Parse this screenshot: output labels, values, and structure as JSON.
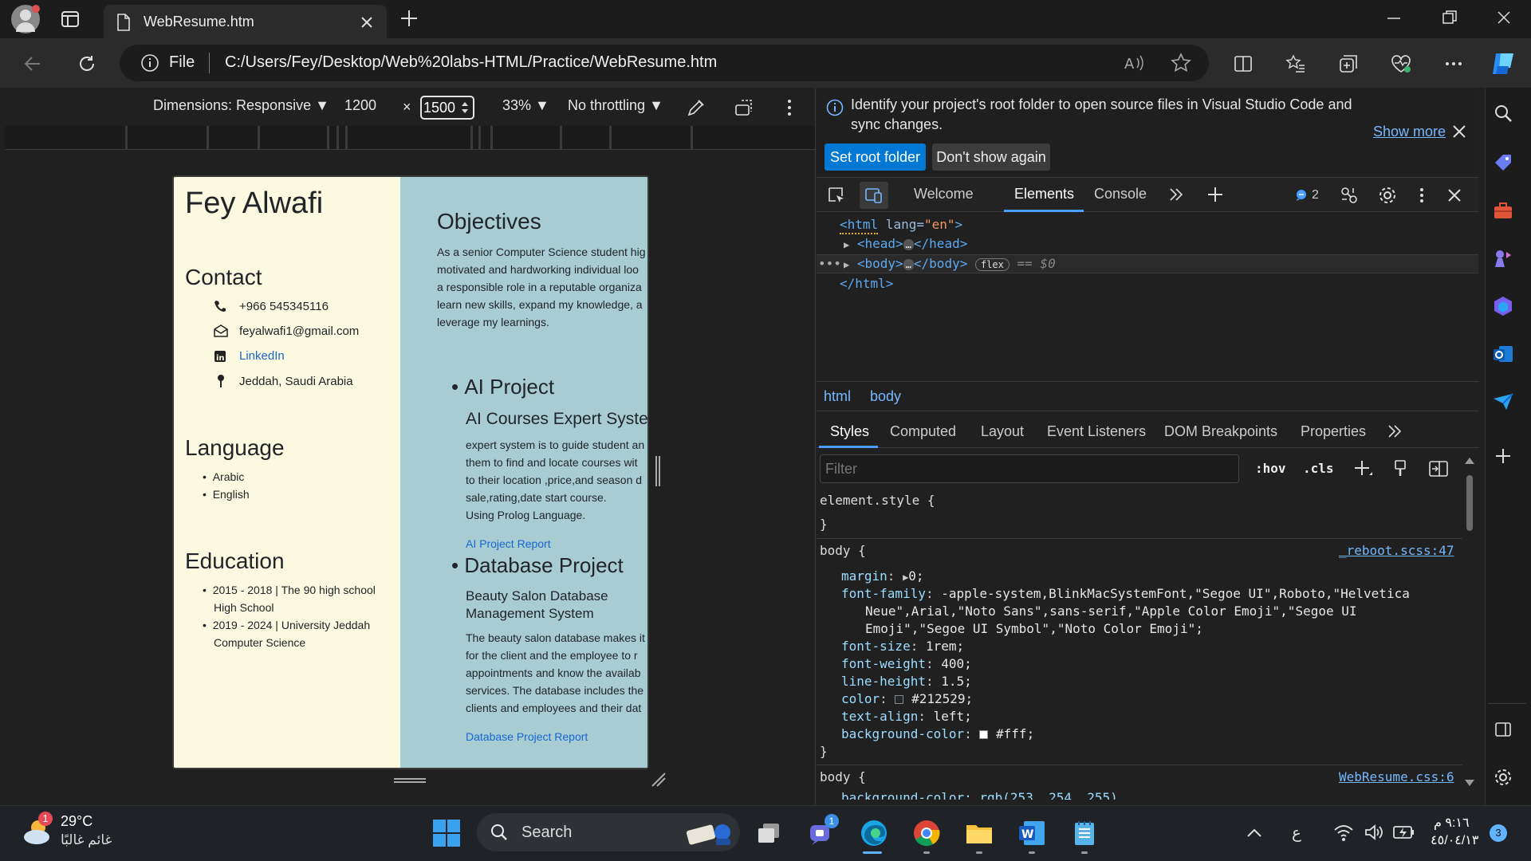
{
  "browser": {
    "tab_title": "WebResume.htm",
    "address_scheme": "File",
    "address": "C:/Users/Fey/Desktop/Web%20labs-HTML/Practice/WebResume.htm"
  },
  "device_toolbar": {
    "dimensions": "Dimensions: Responsive",
    "width": "1200",
    "times": "×",
    "height": "1500",
    "zoom": "33%",
    "throttling": "No throttling"
  },
  "resume": {
    "name": "Fey Alwafi",
    "contact_heading": "Contact",
    "phone": "+966 545345116",
    "email": "feyalwafi1@gmail.com",
    "linkedin": "LinkedIn",
    "location": "Jeddah, Saudi Arabia",
    "language_heading": "Language",
    "languages": [
      "Arabic",
      "English"
    ],
    "education_heading": "Education",
    "education": [
      {
        "line1": "2015 - 2018 | The 90 high school",
        "line2": "High School"
      },
      {
        "line1": "2019 - 2024 | University Jeddah",
        "line2": "Computer Science"
      }
    ],
    "objectives_heading": "Objectives",
    "objectives_lines": [
      "As a senior Computer Science student hig",
      "motivated and hardworking individual loo",
      "a responsible role in a reputable organiza",
      "learn new skills, expand my knowledge, a",
      "leverage my learnings."
    ],
    "ai_project_title": "AI Project",
    "ai_project_subtitle": "AI Courses Expert Syste",
    "ai_project_lines": [
      "expert system is to guide student an",
      "them to find and locate courses wit",
      "to their location ,price,and season d",
      "sale,rating,date start course.",
      "Using Prolog Language."
    ],
    "ai_project_link": "AI Project Report",
    "db_project_title": "Database Project",
    "db_project_subtitle_1": "Beauty Salon Database",
    "db_project_subtitle_2": "Management System",
    "db_project_lines": [
      "The beauty salon database makes it",
      "for the client and the employee to r",
      "appointments and know the availab",
      "services. The database includes the",
      "clients and employees and their dat"
    ],
    "db_project_link": "Database Project Report"
  },
  "devtools": {
    "info_text_1": "Identify your project's root folder to open source files in Visual Studio Code and",
    "info_text_2": "sync changes.",
    "show_more": "Show more",
    "set_root": "Set root folder",
    "dont_show": "Don't show again",
    "tabs": {
      "welcome": "Welcome",
      "elements": "Elements",
      "console": "Console"
    },
    "issues_count": "2",
    "dom": {
      "html_open": "<html",
      "lang_attr": " lang=",
      "lang_val": "\"en\"",
      "gt": ">",
      "head": "<head>",
      "head_close": "</head>",
      "body": "<body>",
      "body_close": "</body>",
      "flex_badge": "flex",
      "eq": "== $0",
      "html_close": "</html>",
      "ellipsis": "…"
    },
    "breadcrumb": [
      "html",
      "body"
    ],
    "style_tabs": [
      "Styles",
      "Computed",
      "Layout",
      "Event Listeners",
      "DOM Breakpoints",
      "Properties"
    ],
    "filter_placeholder": "Filter",
    "hov": ":hov",
    "cls": ".cls",
    "rules": {
      "element_style": "element.style {",
      "close": "}",
      "body_sel": "body {",
      "reboot_src": "_reboot.scss:47",
      "webresume_src": "WebResume.css:6",
      "margin_p": "margin",
      "margin_v": "0;",
      "ff_p": "font-family",
      "ff_v1": "-apple-system,BlinkMacSystemFont,\"Segoe UI\",Roboto,\"Helvetica",
      "ff_v2": "Neue\",Arial,\"Noto Sans\",sans-serif,\"Apple Color Emoji\",\"Segoe UI",
      "ff_v3": "Emoji\",\"Segoe UI Symbol\",\"Noto Color Emoji\";",
      "fs_p": "font-size",
      "fs_v": "1rem;",
      "fw_p": "font-weight",
      "fw_v": "400;",
      "lh_p": "line-height",
      "lh_v": "1.5;",
      "color_p": "color",
      "color_v": "#212529;",
      "ta_p": "text-align",
      "ta_v": "left;",
      "bg_p": "background-color",
      "bg_v": "#fff;",
      "colon": ": ",
      "partial": "background-color:  rgb(253, 254, 255)"
    }
  },
  "taskbar": {
    "weather_temp": "29°C",
    "weather_desc": "غائم غالبًا",
    "weather_badge": "1",
    "search": "Search",
    "teams_badge": "1",
    "lang": "ع",
    "time": "٩:١٦ م",
    "date": "٤٥/٠٤/١٣",
    "notif": "3"
  },
  "colors": {
    "accent": "#0078d4",
    "leftcol": "#fbf9e0",
    "rightcol": "#a7cdd3"
  }
}
